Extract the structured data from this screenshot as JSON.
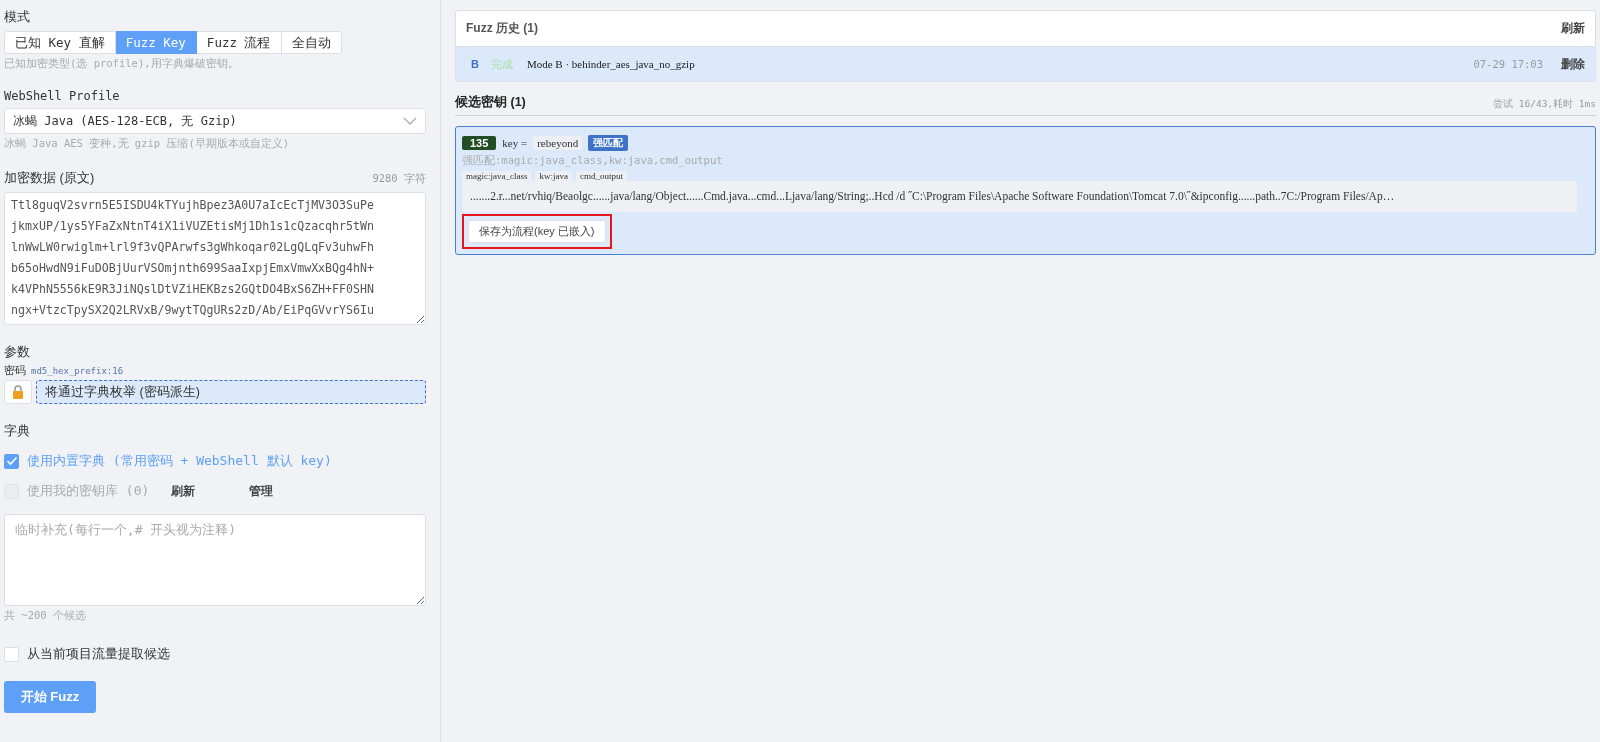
{
  "mode": {
    "label": "模式",
    "tabs": [
      {
        "label": "已知 Key 直解",
        "selected": false
      },
      {
        "label": "Fuzz Key",
        "selected": true
      },
      {
        "label": "Fuzz 流程",
        "selected": false
      },
      {
        "label": "全自动",
        "selected": false
      }
    ],
    "hint": "已知加密类型(选 profile),用字典爆破密钥。"
  },
  "profile": {
    "label": "WebShell Profile",
    "value": "冰蝎 Java (AES-128-ECB, 无 Gzip)",
    "hint": "冰蝎 Java AES 变种,无 gzip 压缩(早期版本或自定义)"
  },
  "cipher": {
    "label": "加密数据 (原文)",
    "count": "9280 字符",
    "value": "Ttl8guqV2svrn5E5ISDU4kTYujhBpez3A0U7aIcEcTjMV3O3SuPe\njkmxUP/1ys5YFaZxNtnT4iX1iVUZEtisMj1Dh1s1cQzacqhr5tWn\nlnWwLW0rwiglm+lrl9f3vQPArwfs3gWhkoqar02LgQLqFv3uhwFh\nb65oHwdN9iFuDOBjUurVSOmjnth699SaaIxpjEmxVmwXxBQg4hN+\nk4VPhN5556kE9R3JiNQslDtVZiHEKBzs2GQtDO4BxS6ZH+FF0SHN\nngx+VtzcTpySX2Q2LRVxB/9wytTQgURs2zD/Ab/EiPqGVvrYS6Iu"
  },
  "params": {
    "label": "参数",
    "password_label": "密码",
    "password_hint": "md5_hex_prefix:16",
    "password_value": "将通过字典枚举 (密码派生)"
  },
  "dictionary": {
    "label": "字典",
    "options": [
      {
        "label": "使用内置字典 (常用密码 + WebShell 默认 key)",
        "checked": true,
        "disabled": false
      },
      {
        "label": "使用我的密钥库 (0)",
        "checked": false,
        "disabled": true,
        "actions": [
          "刷新",
          "管理"
        ]
      }
    ],
    "extra_placeholder": "临时补充(每行一个,# 开头视为注释)",
    "total": "共 ~200 个候选"
  },
  "traffic_option": {
    "label": "从当前项目流量提取候选",
    "checked": false
  },
  "start_button": "开始 Fuzz",
  "history": {
    "title": "Fuzz 历史 (1)",
    "refresh": "刷新",
    "items": [
      {
        "mode": "B",
        "status": "完成",
        "name": "Mode B · behinder_aes_java_no_gzip",
        "time": "07-29 17:03",
        "delete": "删除",
        "selected": true
      }
    ]
  },
  "candidates": {
    "title": "候选密钥 (1)",
    "stats": "尝试 16/43,耗时 1ms",
    "items": [
      {
        "score": "135",
        "key_label": "key =",
        "key": "rebeyond",
        "badge": "强匹配",
        "reason": "强匹配:magic:java_class,kw:java,cmd_output",
        "tags": [
          "magic:java_class",
          "kw:java",
          "cmd_output"
        ],
        "preview": ".......2.r...net/rvhiq/Beaolgc......java/lang/Object......Cmd.java...cmd...Ljava/lang/String;..Hcd /d ˝C:\\Program Files\\Apache Software Foundation\\Tomcat 7.0\\˝&ipconfig......path..7C:/Program Files/Ap…",
        "save_button": "保存为流程(key 已嵌入)",
        "highlighted": true
      }
    ]
  }
}
